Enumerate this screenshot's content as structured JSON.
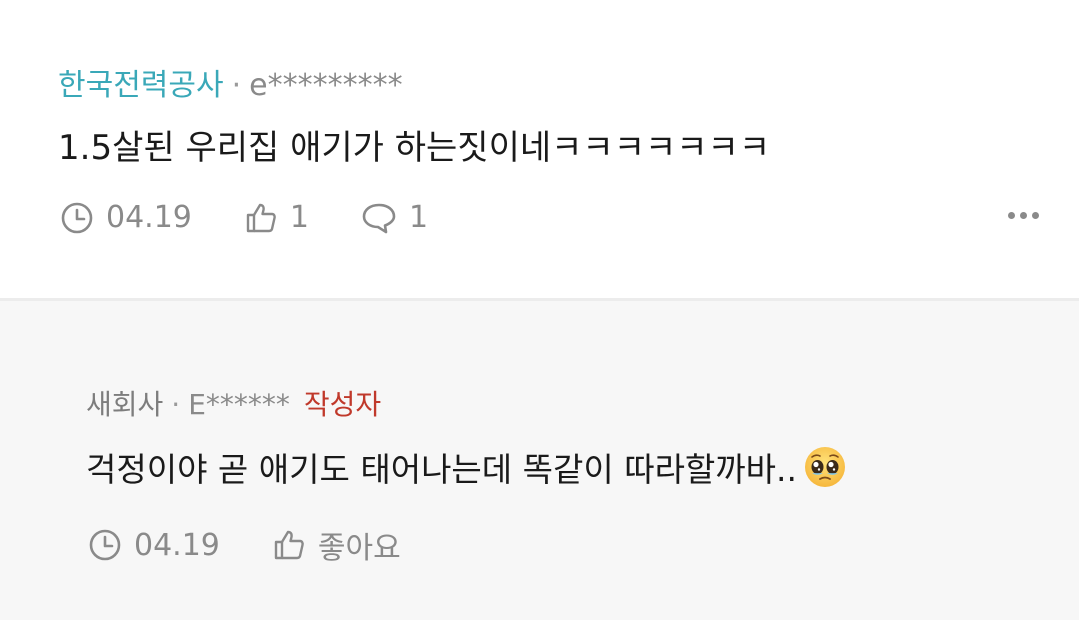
{
  "comments": [
    {
      "company": "한국전력공사",
      "separator": "·",
      "user": "e*********",
      "text": "1.5살된 우리집 애기가 하는짓이네ㅋㅋㅋㅋㅋㅋㅋ",
      "date": "04.19",
      "likes": "1",
      "replies": "1",
      "icons": {
        "clock": "clock-icon",
        "like": "thumbs-up-icon",
        "reply": "speech-bubble-icon",
        "more": "more-dots-icon"
      }
    },
    {
      "company": "새회사",
      "separator": "·",
      "user": "E******",
      "badge": "작성자",
      "text": "걱정이야 곧 애기도 태어나는데 똑같이 따라할까바..",
      "emoji": "pleading-face-emoji",
      "date": "04.19",
      "like_label": "좋아요",
      "icons": {
        "clock": "clock-icon",
        "like": "thumbs-up-icon"
      }
    }
  ],
  "colors": {
    "company_accent": "#3aa8b8",
    "author_badge": "#c0392b",
    "reply_background": "#f7f7f7"
  }
}
